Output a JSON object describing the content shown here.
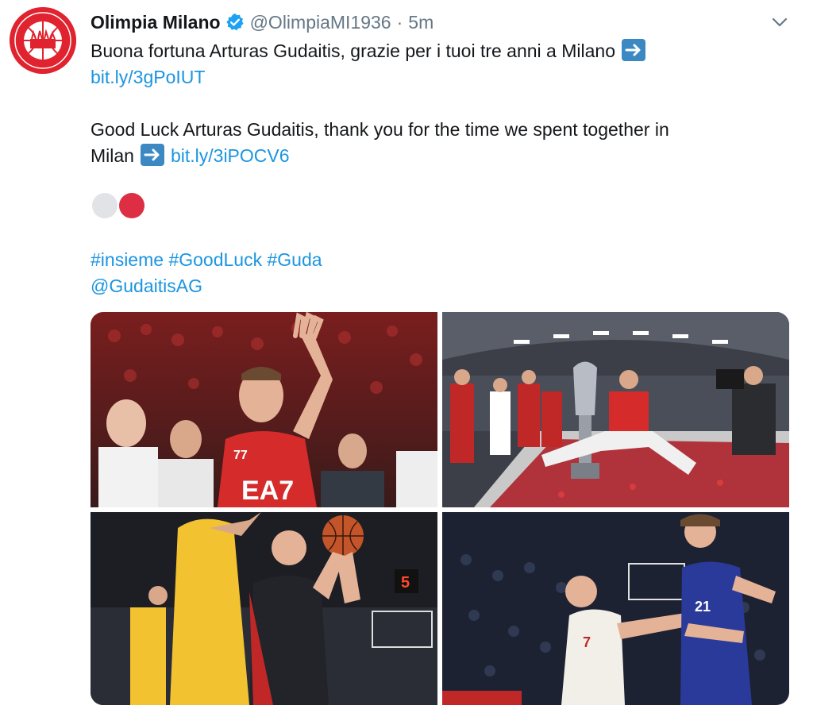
{
  "account": {
    "name": "Olimpia Milano",
    "handle": "@OlimpiaMI1936",
    "separator": "·",
    "time": "5m",
    "avatar_text_top": "Olimpia",
    "avatar_text_bottom": "Milano"
  },
  "tweet": {
    "line_it": "Buona fortuna Arturas Gudaitis, grazie per i tuoi tre anni a Milano",
    "link_it": "bit.ly/3gPoIUT",
    "line_en_1": "Good Luck Arturas Gudaitis, thank you for the time we spent together in",
    "line_en_2_prefix": "Milan",
    "link_en": "bit.ly/3iPOCV6",
    "hashtags": [
      "#insieme",
      "#GoodLuck",
      "#Guda"
    ],
    "mention": "@GudaitisAG"
  },
  "emoji": {
    "white_circle": "#e1e3e6",
    "red_circle": "#dd2e44",
    "arrow_box": "#3b88c3"
  },
  "colors": {
    "link": "#1b95e0",
    "name": "#14171a",
    "secondary": "#657786",
    "verified": "#1da1f2",
    "brand_red": "#e0232e"
  },
  "icons": [
    "verified-badge-icon",
    "chevron-down-icon",
    "right-arrow-emoji-icon"
  ],
  "photos": {
    "top_left": {
      "jersey_number": "77",
      "jersey_text": "EA7"
    },
    "top_right": {},
    "bottom_left": {
      "shot_clock": "5"
    },
    "bottom_right": {
      "jersey_number_left": "7",
      "jersey_number_right": "21"
    }
  }
}
